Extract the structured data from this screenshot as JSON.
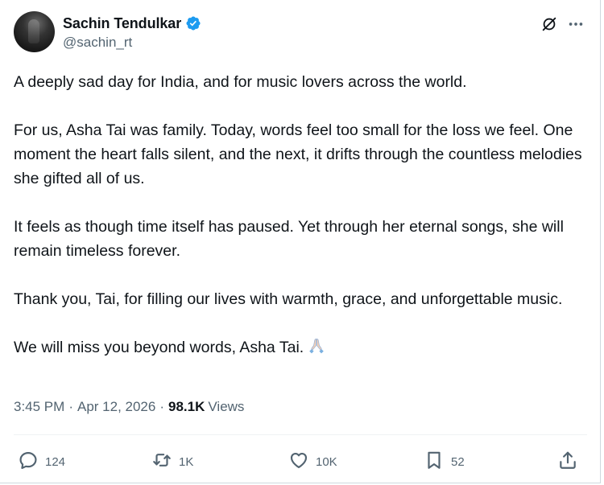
{
  "author": {
    "display_name": "Sachin Tendulkar",
    "handle": "@sachin_rt",
    "verified": true,
    "avatar_icon": "avatar-photo"
  },
  "header_icons": {
    "grok": "grok-icon",
    "more": "more-icon"
  },
  "tweet": {
    "paragraphs": [
      "A deeply sad day for India, and for music lovers across the world.",
      "For us, Asha Tai was family. Today, words feel too small for the loss we feel. One moment the heart falls silent, and the next, it drifts through the countless melodies she gifted all of us.",
      "It feels as though time itself has paused. Yet through her eternal songs, she will remain timeless forever.",
      "Thank you, Tai, for filling our lives with warmth, grace, and unforgettable music.",
      "We will miss you beyond words, Asha Tai."
    ],
    "emoji": "folded-hands-emoji"
  },
  "meta": {
    "time": "3:45 PM",
    "separator": "·",
    "date": "Apr 12, 2026",
    "views_count": "98.1K",
    "views_label": "Views"
  },
  "actions": {
    "reply_count": "124",
    "repost_count": "1K",
    "like_count": "10K",
    "bookmark_count": "52"
  },
  "colors": {
    "text_primary": "#0f1419",
    "text_secondary": "#536471",
    "verified_blue": "#1d9bf0",
    "divider": "#eff3f4"
  }
}
